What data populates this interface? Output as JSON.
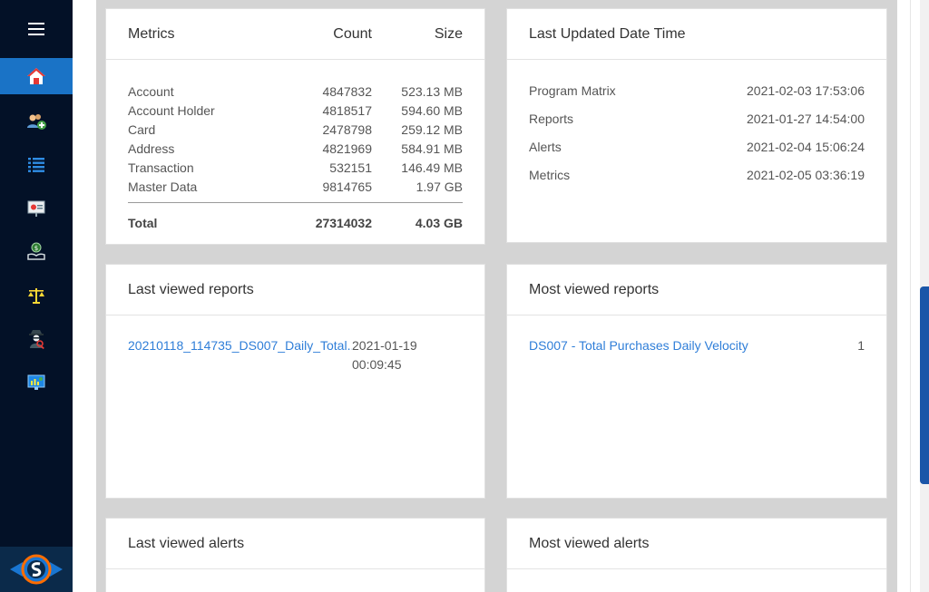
{
  "metrics": {
    "title": "Metrics",
    "count_header": "Count",
    "size_header": "Size",
    "rows": [
      {
        "name": "Account",
        "count": "4847832",
        "size": "523.13 MB"
      },
      {
        "name": "Account Holder",
        "count": "4818517",
        "size": "594.60 MB"
      },
      {
        "name": "Card",
        "count": "2478798",
        "size": "259.12 MB"
      },
      {
        "name": "Address",
        "count": "4821969",
        "size": "584.91 MB"
      },
      {
        "name": "Transaction",
        "count": "532151",
        "size": "146.49 MB"
      },
      {
        "name": "Master Data",
        "count": "9814765",
        "size": "1.97 GB"
      }
    ],
    "total": {
      "name": "Total",
      "count": "27314032",
      "size": "4.03 GB"
    }
  },
  "last_updated": {
    "title": "Last Updated Date Time",
    "rows": [
      {
        "name": "Program Matrix",
        "value": "2021-02-03 17:53:06"
      },
      {
        "name": "Reports",
        "value": "2021-01-27 14:54:00"
      },
      {
        "name": "Alerts",
        "value": "2021-02-04 15:06:24"
      },
      {
        "name": "Metrics",
        "value": "2021-02-05 03:36:19"
      }
    ]
  },
  "last_viewed_reports": {
    "title": "Last viewed reports",
    "items": [
      {
        "name": "20210118_114735_DS007_Daily_Total...",
        "date": "2021-01-19",
        "time": "00:09:45"
      }
    ]
  },
  "most_viewed_reports": {
    "title": "Most viewed reports",
    "items": [
      {
        "name": "DS007 - Total Purchases Daily Velocity",
        "count": "1"
      }
    ]
  },
  "last_viewed_alerts": {
    "title": "Last viewed alerts"
  },
  "most_viewed_alerts": {
    "title": "Most viewed alerts"
  },
  "sidebar": {
    "icons": [
      "home-icon",
      "add-user-icon",
      "list-icon",
      "presentation-icon",
      "money-hand-icon",
      "scales-icon",
      "spy-search-icon",
      "dashboard-monitor-icon"
    ]
  },
  "colors": {
    "sidebar": "#031127",
    "active": "#1a73c6",
    "link": "#2f7ed8",
    "background": "#d4d4d4"
  }
}
